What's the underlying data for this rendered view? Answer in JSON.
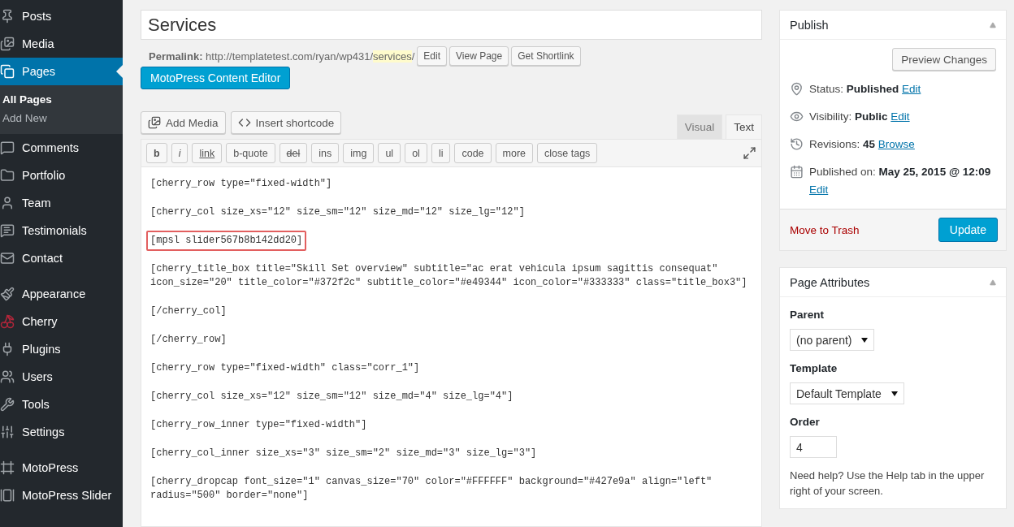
{
  "sidebar": {
    "groups": [
      [
        {
          "label": "Posts",
          "selected": false
        },
        {
          "label": "Media",
          "selected": false
        },
        {
          "label": "Pages",
          "selected": true,
          "children": [
            {
              "label": "All Pages",
              "selected": true
            },
            {
              "label": "Add New",
              "selected": false
            }
          ]
        },
        {
          "label": "Comments",
          "selected": false
        },
        {
          "label": "Portfolio",
          "selected": false
        },
        {
          "label": "Team",
          "selected": false
        },
        {
          "label": "Testimonials",
          "selected": false
        },
        {
          "label": "Contact",
          "selected": false
        }
      ],
      [
        {
          "label": "Appearance",
          "selected": false
        },
        {
          "label": "Cherry",
          "selected": false
        },
        {
          "label": "Plugins",
          "selected": false
        },
        {
          "label": "Users",
          "selected": false
        },
        {
          "label": "Tools",
          "selected": false
        },
        {
          "label": "Settings",
          "selected": false
        }
      ],
      [
        {
          "label": "MotoPress",
          "selected": false
        },
        {
          "label": "MotoPress Slider",
          "selected": false
        }
      ]
    ]
  },
  "title_field": {
    "value": "Services"
  },
  "permalink": {
    "label": "Permalink:",
    "url": "http://templatetest.com/ryan/wp431/",
    "slug": "services",
    "trail": "/",
    "buttons": [
      "Edit",
      "View Page",
      "Get Shortlink"
    ]
  },
  "content_editor_button": "MotoPress Content Editor",
  "media_buttons": [
    "Add Media",
    "Insert shortcode"
  ],
  "editor_tabs": [
    {
      "label": "Visual",
      "selected": false
    },
    {
      "label": "Text",
      "selected": true
    }
  ],
  "quicktags": [
    {
      "label": "b",
      "kind": "bold"
    },
    {
      "label": "i",
      "kind": "italic"
    },
    {
      "label": "link",
      "kind": "link"
    },
    {
      "label": "b-quote",
      "kind": "plain"
    },
    {
      "label": "del",
      "kind": "strike"
    },
    {
      "label": "ins",
      "kind": "plain"
    },
    {
      "label": "img",
      "kind": "plain"
    },
    {
      "label": "ul",
      "kind": "plain"
    },
    {
      "label": "ol",
      "kind": "plain"
    },
    {
      "label": "li",
      "kind": "plain"
    },
    {
      "label": "code",
      "kind": "plain"
    },
    {
      "label": "more",
      "kind": "plain"
    },
    {
      "label": "close tags",
      "kind": "plain"
    }
  ],
  "code_lines": [
    {
      "text": "[cherry_row type=\"fixed-width\"]",
      "highlighted": false
    },
    {
      "text": "[cherry_col size_xs=\"12\" size_sm=\"12\" size_md=\"12\" size_lg=\"12\"]",
      "highlighted": false
    },
    {
      "text": "[mpsl slider567b8b142dd20]",
      "highlighted": true
    },
    {
      "text": "[cherry_title_box title=\"Skill Set overview\" subtitle=\"ac erat vehicula ipsum sagittis consequat\"\nicon_size=\"20\" title_color=\"#372f2c\" subtitle_color=\"#e49344\" icon_color=\"#333333\" class=\"title_box3\"]",
      "highlighted": false
    },
    {
      "text": "[/cherry_col]",
      "highlighted": false
    },
    {
      "text": "[/cherry_row]",
      "highlighted": false
    },
    {
      "text": "[cherry_row type=\"fixed-width\" class=\"corr_1\"]",
      "highlighted": false
    },
    {
      "text": "[cherry_col size_xs=\"12\" size_sm=\"12\" size_md=\"4\" size_lg=\"4\"]",
      "highlighted": false
    },
    {
      "text": "[cherry_row_inner type=\"fixed-width\"]",
      "highlighted": false
    },
    {
      "text": "[cherry_col_inner size_xs=\"3\" size_sm=\"2\" size_md=\"3\" size_lg=\"3\"]",
      "highlighted": false
    },
    {
      "text": "[cherry_dropcap font_size=\"1\" canvas_size=\"70\" color=\"#FFFFFF\" background=\"#427e9a\" align=\"left\"\nradius=\"500\" border=\"none\"]",
      "highlighted": false
    }
  ],
  "publish": {
    "title": "Publish",
    "preview_button": "Preview Changes",
    "rows": [
      {
        "label": "Status:",
        "value": "Published",
        "link": "Edit"
      },
      {
        "label": "Visibility:",
        "value": "Public",
        "link": "Edit"
      },
      {
        "label": "Revisions:",
        "value": "45",
        "link": "Browse"
      },
      {
        "label": "Published on:",
        "value": "May 25, 2015 @ 12:09",
        "link": "Edit"
      }
    ],
    "trash_link": "Move to Trash",
    "update_button": "Update"
  },
  "page_attributes": {
    "title": "Page Attributes",
    "parent_label": "Parent",
    "parent_value": "(no parent)",
    "template_label": "Template",
    "template_value": "Default Template",
    "order_label": "Order",
    "order_value": "4",
    "help": "Need help? Use the Help tab in the upper right of your screen."
  }
}
